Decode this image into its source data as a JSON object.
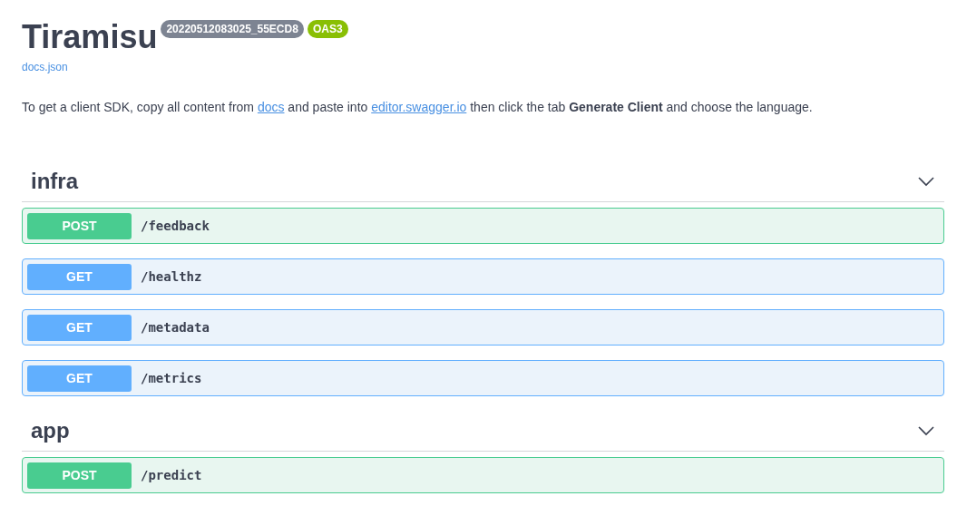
{
  "title": "Tiramisu",
  "version_badge": "20220512083025_55ECD8",
  "spec_badge": "OAS3",
  "spec_link": "docs.json",
  "description_parts": [
    {
      "kind": "text",
      "text": "To get a client SDK, copy all content from "
    },
    {
      "kind": "link",
      "text": "docs"
    },
    {
      "kind": "text",
      "text": " and paste into "
    },
    {
      "kind": "link",
      "text": "editor.swagger.io"
    },
    {
      "kind": "text",
      "text": " then click the tab **Generate Client** and choose the language."
    }
  ],
  "sections": [
    {
      "name": "infra",
      "expanded": true,
      "operations": [
        {
          "kind": "post",
          "method": "POST",
          "path": "/feedback"
        },
        {
          "kind": "get",
          "method": "GET",
          "path": "/healthz"
        },
        {
          "kind": "get",
          "method": "GET",
          "path": "/metadata"
        },
        {
          "kind": "get",
          "method": "GET",
          "path": "/metrics"
        }
      ]
    },
    {
      "name": "app",
      "expanded": true,
      "operations": [
        {
          "kind": "post",
          "method": "POST",
          "path": "/predict"
        }
      ]
    }
  ]
}
